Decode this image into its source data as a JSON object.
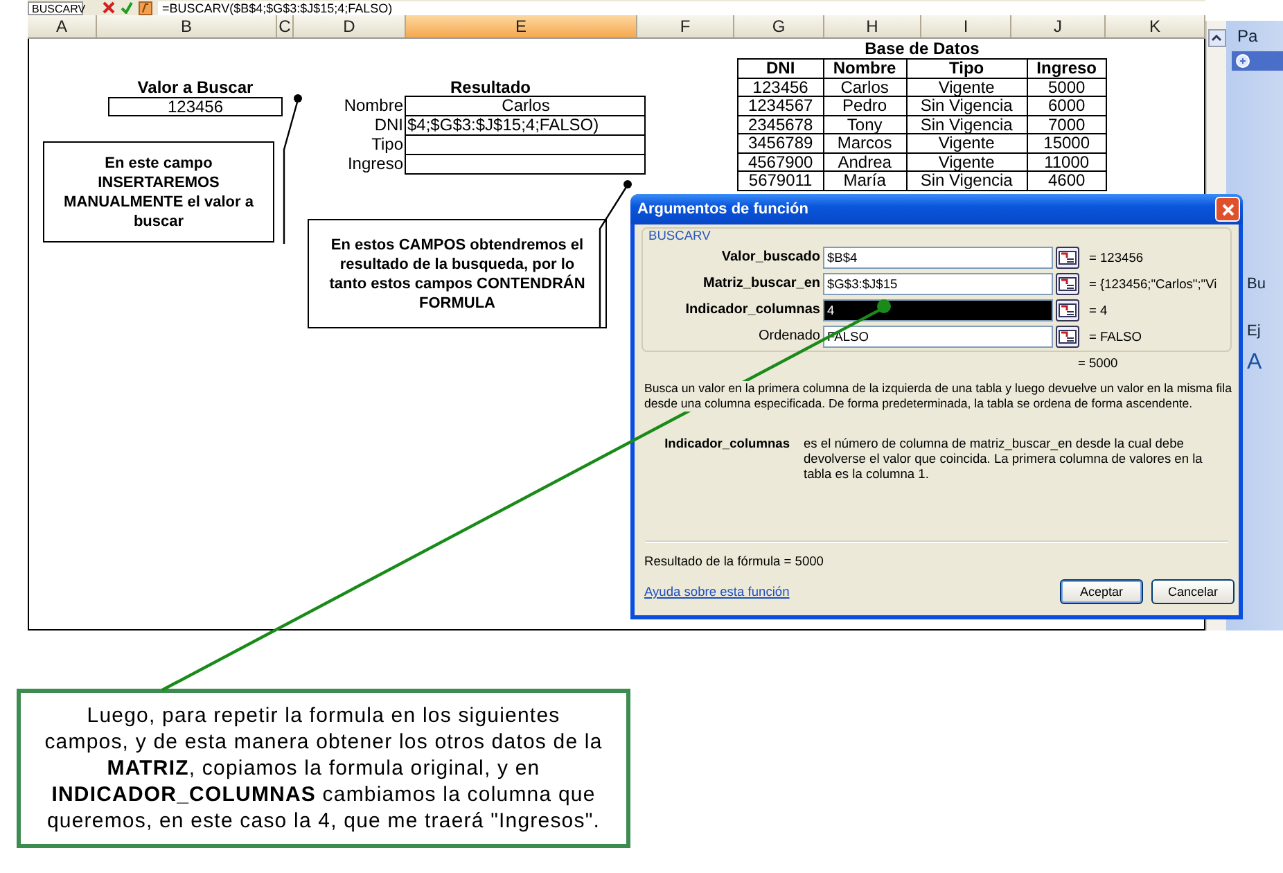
{
  "formula_bar": {
    "name_box": "BUSCARV",
    "formula": "=BUSCARV($B$4;$G$3:$J$15;4;FALSO)"
  },
  "columns": [
    {
      "label": "A",
      "selected": false
    },
    {
      "label": "B",
      "selected": false
    },
    {
      "label": "C",
      "selected": false
    },
    {
      "label": "D",
      "selected": false
    },
    {
      "label": "E",
      "selected": true
    },
    {
      "label": "F",
      "selected": false
    },
    {
      "label": "G",
      "selected": false
    },
    {
      "label": "H",
      "selected": false
    },
    {
      "label": "I",
      "selected": false
    },
    {
      "label": "J",
      "selected": false
    },
    {
      "label": "K",
      "selected": false
    }
  ],
  "lookup": {
    "title": "Valor a Buscar",
    "value": "123456"
  },
  "note_1": "En este campo INSERTAREMOS MANUALMENTE el valor a buscar",
  "result": {
    "title": "Resultado",
    "fields": [
      {
        "label": "Nombre",
        "value": "Carlos",
        "kind": "text"
      },
      {
        "label": "DNI",
        "value": "$4;$G$3:$J$15;4;FALSO)",
        "kind": "formula"
      },
      {
        "label": "Tipo"
      },
      {
        "label": "Ingreso"
      }
    ]
  },
  "note_2": "En estos CAMPOS obtendremos el resultado de la busqueda, por lo tanto estos campos CONTENDRÁN FORMULA",
  "database": {
    "title": "Base de Datos",
    "columns": [
      "DNI",
      "Nombre",
      "Tipo",
      "Ingreso"
    ],
    "rows": [
      [
        "123456",
        "Carlos",
        "Vigente",
        "5000"
      ],
      [
        "1234567",
        "Pedro",
        "Sin Vigencia",
        "6000"
      ],
      [
        "2345678",
        "Tony",
        "Sin Vigencia",
        "7000"
      ],
      [
        "3456789",
        "Marcos",
        "Vigente",
        "15000"
      ],
      [
        "4567900",
        "Andrea",
        "Vigente",
        "11000"
      ],
      [
        "5679011",
        "María",
        "Sin Vigencia",
        "4600"
      ]
    ]
  },
  "dialog": {
    "title": "Argumentos de función",
    "function": "BUSCARV",
    "arguments": [
      {
        "label": "Valor_buscado",
        "value": "$B$4",
        "result": "= 123456",
        "required": true,
        "selected": false
      },
      {
        "label": "Matriz_buscar_en",
        "value": "$G$3:$J$15",
        "result": "= {123456;\"Carlos\";\"Vi",
        "required": true,
        "selected": false
      },
      {
        "label": "Indicador_columnas",
        "value": "4",
        "result": "= 4",
        "required": true,
        "selected": true
      },
      {
        "label": "Ordenado",
        "value": "FALSO",
        "result": "= FALSO",
        "required": false,
        "selected": false
      }
    ],
    "function_result": "= 5000",
    "description": "Busca un valor en la primera columna de la izquierda de una tabla y luego devuelve un valor en la misma fila desde una columna especificada. De forma predeterminada, la tabla se ordena de forma ascendente.",
    "argument_help": {
      "name": "Indicador_columnas",
      "text": "es el número de columna de matriz_buscar_en desde la cual debe devolverse el valor que coincida. La primera columna de valores en la tabla es la columna 1."
    },
    "formula_result": "Resultado de la fórmula =  5000",
    "help_link": "Ayuda sobre esta función",
    "buttons": [
      "Aceptar",
      "Cancelar"
    ]
  },
  "callout": "Luego, para repetir la formula en los siguientes campos, y de esta manera obtener los otros datos de la **MATRIZ**, copiamos la formula original, y en **INDICADOR_COLUMNAS** cambiamos la columna que queremos, en este caso la 4, que me traerá \"Ingresos\".",
  "task_pane": [
    "Pa",
    "Bu",
    "Ej",
    "A"
  ]
}
